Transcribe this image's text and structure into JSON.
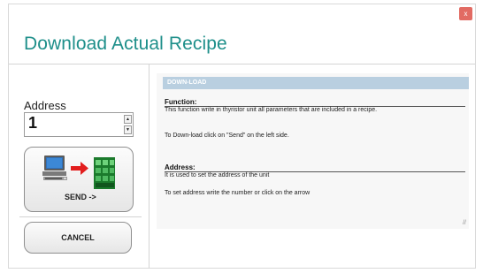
{
  "window": {
    "title": "Download Actual Recipe",
    "close_glyph": "x"
  },
  "address": {
    "label": "Address",
    "value": "1",
    "spin_up": "▲",
    "spin_down": "▼"
  },
  "buttons": {
    "send_label": "SEND ->",
    "cancel_label": "CANCEL"
  },
  "help": {
    "header": "DOWN-LOAD",
    "function_title": "Function:",
    "function_text": "This function write in thyristor unit all parameters that are included in a recipe.",
    "function_note": "To Down-load click on \"Send\" on the left side.",
    "address_title": "Address:",
    "address_text": "It is used to set the address of the unit",
    "address_note": "To set address write the number or click on the arrow",
    "resize_glyph": "//"
  },
  "colors": {
    "title": "#1e8f8a",
    "help_header": "#b9cfe0",
    "close": "#e26b63"
  },
  "icons": [
    "close-icon",
    "computer-icon",
    "arrow-right-icon",
    "thyristor-unit-icon",
    "resize-grip-icon"
  ]
}
